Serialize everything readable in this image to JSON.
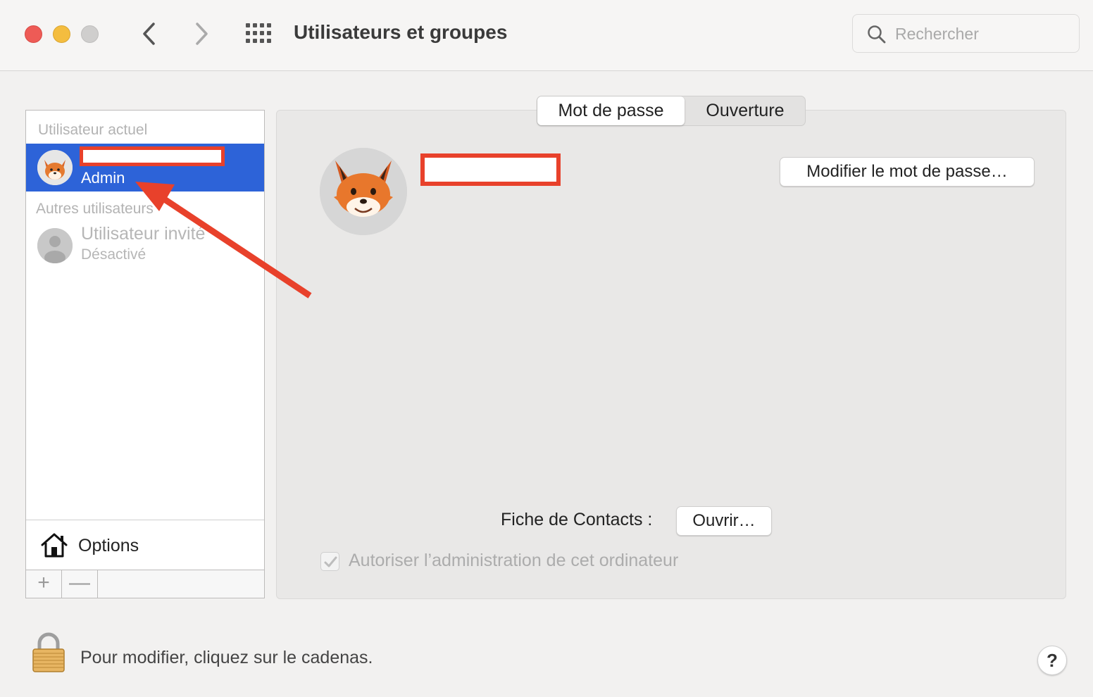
{
  "window": {
    "title": "Utilisateurs et groupes",
    "search_placeholder": "Rechercher"
  },
  "sidebar": {
    "current_user_header": "Utilisateur actuel",
    "current_user": {
      "role": "Admin",
      "avatar": "fox-memoji-icon"
    },
    "other_users_header": "Autres utilisateurs",
    "guest_user": {
      "name": "Utilisateur invité",
      "status": "Désactivé",
      "avatar": "generic-user-icon"
    },
    "options_label": "Options",
    "add_label": "+",
    "remove_label": "—"
  },
  "tabs": [
    {
      "label": "Mot de passe",
      "selected": true
    },
    {
      "label": "Ouverture",
      "selected": false
    }
  ],
  "main": {
    "change_password_label": "Modifier le mot de passe…",
    "contacts_label": "Fiche de Contacts :",
    "open_label": "Ouvrir…",
    "admin_checkbox_label": "Autoriser l’administration de cet ordinateur",
    "admin_checkbox_checked": true
  },
  "footer": {
    "lock_text": "Pour modifier, cliquez sur le cadenas.",
    "help_label": "?"
  },
  "colors": {
    "selection": "#2d63d8",
    "redaction": "#e8412b"
  }
}
